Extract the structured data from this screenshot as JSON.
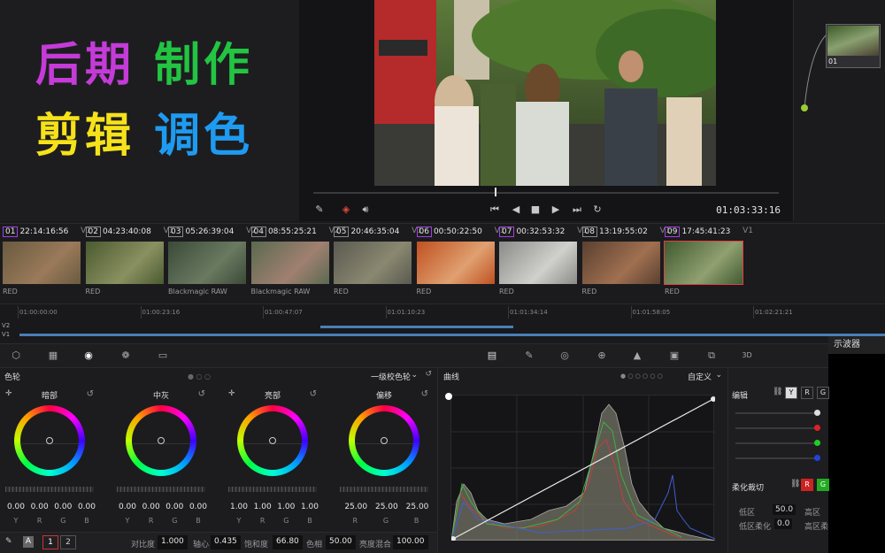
{
  "promo": {
    "line1": [
      {
        "text": "后期",
        "color": "#c43bd8"
      },
      {
        "text": "制作",
        "color": "#23c442"
      }
    ],
    "line2": [
      {
        "text": "剪辑",
        "color": "#f5e21a"
      },
      {
        "text": "调色",
        "color": "#1e9bf0"
      }
    ]
  },
  "viewer": {
    "timecode": "01:03:33:16",
    "icons": [
      "picker-icon",
      "layers-icon",
      "audio-icon",
      "first-frame-icon",
      "prev-icon",
      "stop-icon",
      "play-icon",
      "next-icon",
      "loop-icon"
    ]
  },
  "node": {
    "label": "01"
  },
  "clips": [
    {
      "num": "01",
      "tc": "22:14:16:56",
      "track": "V1",
      "codec": "RED",
      "colors": [
        "#6a5a40",
        "#9a7a5a"
      ]
    },
    {
      "num": "02",
      "tc": "04:23:40:08",
      "track": "V1",
      "codec": "RED",
      "colors": [
        "#4a5a30",
        "#8a9060"
      ]
    },
    {
      "num": "03",
      "tc": "05:26:39:04",
      "track": "V2",
      "codec": "Blackmagic RAW",
      "colors": [
        "#3a4a38",
        "#6a7a60"
      ]
    },
    {
      "num": "04",
      "tc": "08:55:25:21",
      "track": "V2",
      "codec": "Blackmagic RAW",
      "colors": [
        "#5a6a50",
        "#a08070"
      ]
    },
    {
      "num": "05",
      "tc": "20:46:35:04",
      "track": "V1",
      "codec": "RED",
      "colors": [
        "#5a5a50",
        "#8a8870"
      ]
    },
    {
      "num": "06",
      "tc": "00:50:22:50",
      "track": "V1",
      "codec": "RED",
      "colors": [
        "#c05020",
        "#e0a070"
      ]
    },
    {
      "num": "07",
      "tc": "00:32:53:32",
      "track": "V1",
      "codec": "RED",
      "colors": [
        "#8a8a88",
        "#d0d0cc"
      ]
    },
    {
      "num": "08",
      "tc": "13:19:55:02",
      "track": "V1",
      "codec": "RED",
      "colors": [
        "#5a4030",
        "#a07050"
      ]
    },
    {
      "num": "09",
      "tc": "17:45:41:23",
      "track": "V1",
      "codec": "RED",
      "colors": [
        "#405a30",
        "#90a070"
      ]
    }
  ],
  "timeline": {
    "marks": [
      "01:00:00:00",
      "01:00:23:16",
      "01:00:47:07",
      "01:01:10:23",
      "01:01:34:14",
      "01:01:58:05",
      "01:02:21:21"
    ],
    "tracks": [
      "V2",
      "V1"
    ]
  },
  "scope": {
    "title": "示波器"
  },
  "wheels": {
    "title": "色轮",
    "mode": "一级校色轮",
    "items": [
      {
        "label": "暗部",
        "values": [
          "0.00",
          "0.00",
          "0.00",
          "0.00"
        ],
        "channels": [
          "Y",
          "R",
          "G",
          "B"
        ]
      },
      {
        "label": "中灰",
        "values": [
          "0.00",
          "0.00",
          "0.00",
          "0.00"
        ],
        "channels": [
          "Y",
          "R",
          "G",
          "B"
        ]
      },
      {
        "label": "亮部",
        "values": [
          "1.00",
          "1.00",
          "1.00",
          "1.00"
        ],
        "channels": [
          "Y",
          "R",
          "G",
          "B"
        ]
      },
      {
        "label": "偏移",
        "values": [
          "25.00",
          "25.00",
          "25.00"
        ],
        "channels": [
          "R",
          "G",
          "B"
        ]
      }
    ],
    "footer": {
      "page1": "1",
      "page2": "2",
      "auto_label": "A",
      "contrast_label": "对比度",
      "contrast_value": "1.000",
      "pivot_label": "轴心",
      "pivot_value": "0.435",
      "saturation_label": "饱和度",
      "saturation_value": "66.80",
      "hue_label": "色相",
      "hue_value": "50.00",
      "lum_mix_label": "亮度混合",
      "lum_mix_value": "100.00"
    }
  },
  "curves": {
    "title": "曲线",
    "mode": "自定义"
  },
  "edit": {
    "title": "编辑",
    "channels": [
      "Y",
      "R",
      "G"
    ],
    "soft_clip_title": "柔化裁切",
    "soft_buttons": [
      "R",
      "G"
    ],
    "low_label": "低区",
    "low_value": "50.0",
    "high_label": "高区",
    "low_soft_label": "低区柔化",
    "low_soft_value": "0.0",
    "high_soft_label": "高区柔"
  }
}
